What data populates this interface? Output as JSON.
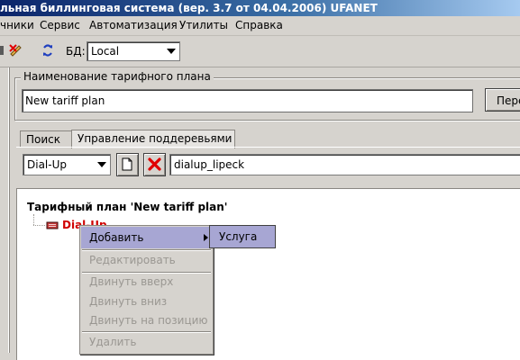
{
  "window": {
    "title": "льная биллинговая система (вер. 3.7 от 04.04.2006) UFANET"
  },
  "menu": {
    "items": [
      "чники",
      "Сервис",
      "Автоматизация",
      "Утилиты",
      "Справка"
    ]
  },
  "toolbar": {
    "db_label": "БД:",
    "db_value": "Local"
  },
  "tariff_group": {
    "legend": "Наименование тарифного плана",
    "name_value": "New tariff plan",
    "button_label": "Пере"
  },
  "tabs": [
    {
      "label": "Поиск",
      "active": false
    },
    {
      "label": "Управление поддеревьями",
      "active": true
    }
  ],
  "subtree": {
    "type_value": "Dial-Up",
    "name_value": "dialup_lipeck"
  },
  "tree": {
    "root_label": "Тарифный план 'New tariff plan'",
    "child_label": "Dial-Up"
  },
  "context_menu": {
    "items": [
      {
        "label": "Добавить",
        "enabled": true,
        "highlighted": true,
        "has_submenu": true
      },
      {
        "label": "Редактировать",
        "enabled": false
      },
      {
        "label": "Двинуть вверх",
        "enabled": false
      },
      {
        "label": "Двинуть вниз",
        "enabled": false
      },
      {
        "label": "Двинуть на позицию",
        "enabled": false
      },
      {
        "label": "Удалить",
        "enabled": false
      }
    ],
    "submenu_item": "Услуга"
  },
  "colors": {
    "title_gradient_start": "#0a246a",
    "title_gradient_end": "#a6caf0",
    "menu_highlight": "#a7a6d3",
    "tree_child_text": "#d00000",
    "delete_icon": "#e00000"
  }
}
